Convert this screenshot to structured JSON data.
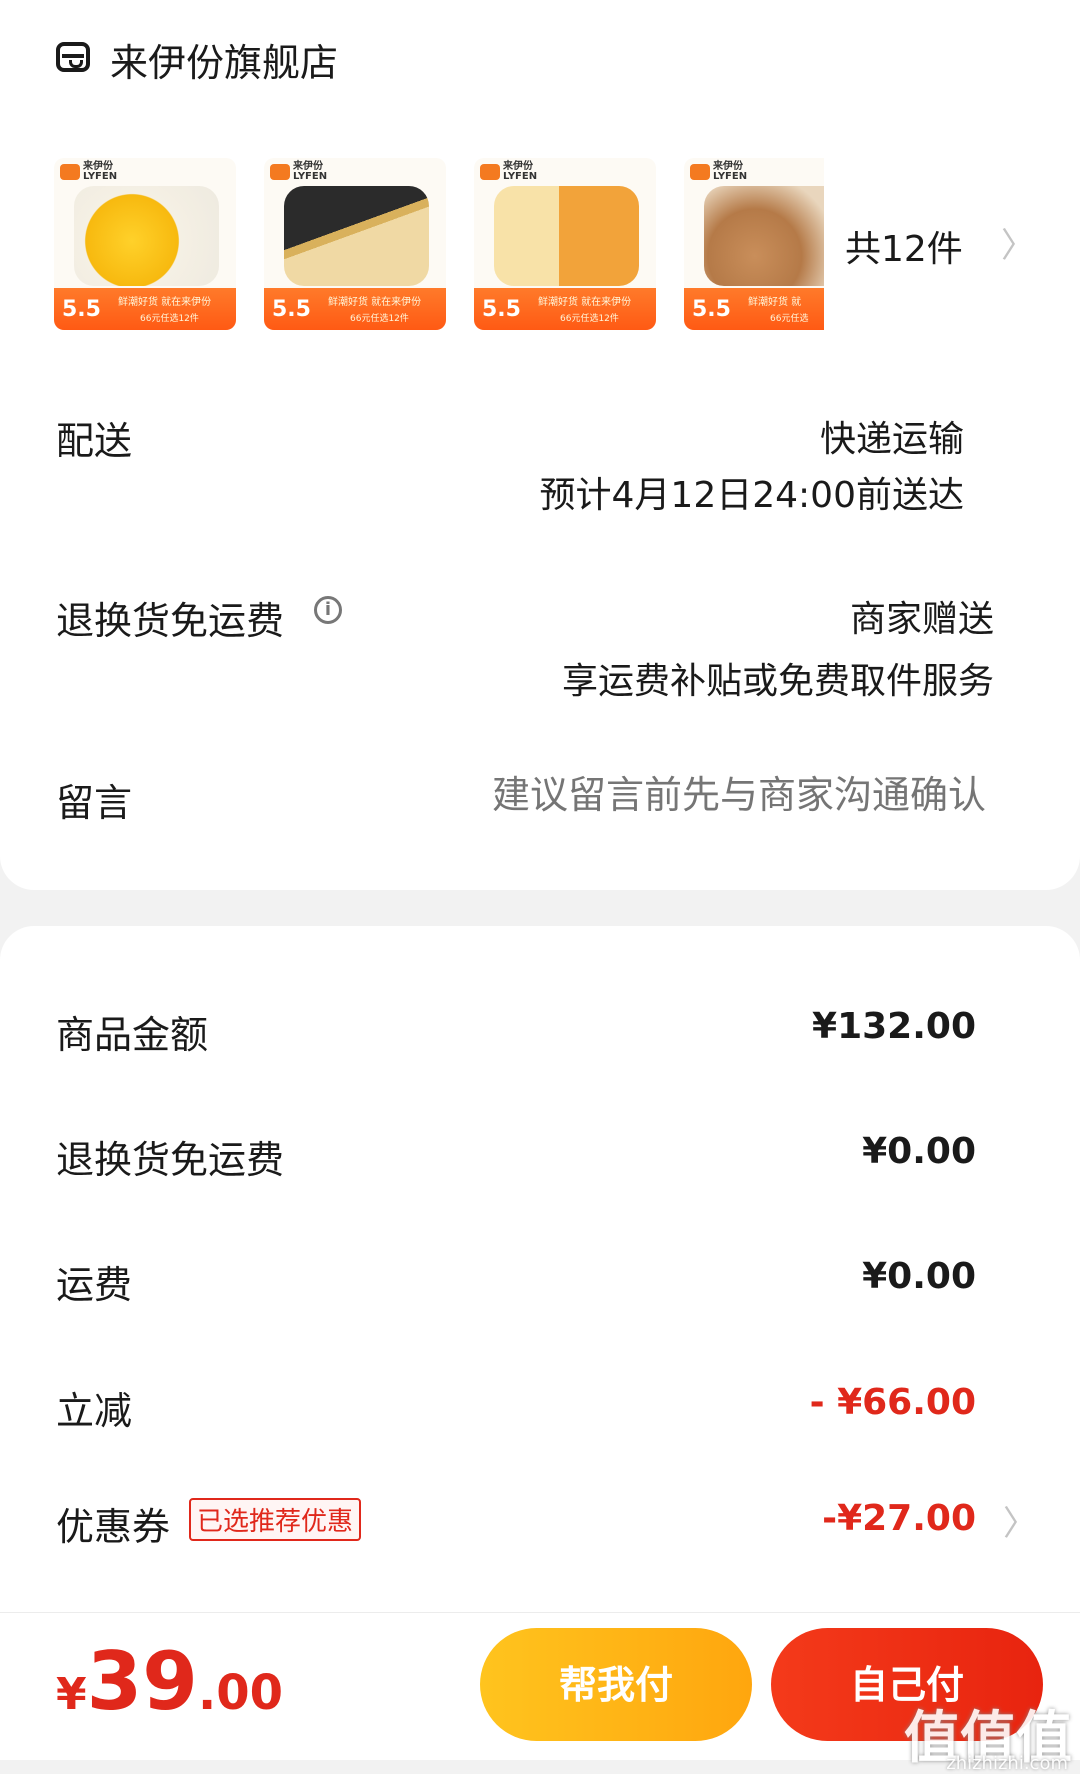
{
  "shop": {
    "name": "来伊份旗舰店"
  },
  "products": {
    "items": [
      {
        "brand_cn": "来伊份",
        "brand_en": "LYFEN",
        "price": "5.5",
        "pitch": "鲜潮好货 就在来伊份",
        "deal": "66元任选12件",
        "color": "#f7c21b"
      },
      {
        "brand_cn": "来伊份",
        "brand_en": "LYFEN",
        "price": "5.5",
        "pitch": "鲜潮好货 就在来伊份",
        "deal": "66元任选12件",
        "color": "#e2b45a"
      },
      {
        "brand_cn": "来伊份",
        "brand_en": "LYFEN",
        "price": "5.5",
        "pitch": "鲜潮好货 就在来伊份",
        "deal": "66元任选12件",
        "color": "#f0a43a"
      },
      {
        "brand_cn": "来伊份",
        "brand_en": "LYFEN",
        "price": "5.5",
        "pitch": "鲜潮好货 就",
        "deal": "66元任选",
        "color": "#c98e5a"
      }
    ],
    "count_label": "共12件"
  },
  "delivery": {
    "label": "配送",
    "method": "快递运输",
    "eta": "预计4月12日24:00前送达"
  },
  "return_shipping": {
    "label": "退换货免运费",
    "value": "商家赠送",
    "desc": "享运费补贴或免费取件服务"
  },
  "remark": {
    "label": "留言",
    "placeholder": "建议留言前先与商家沟通确认"
  },
  "summary": {
    "goods_label": "商品金额",
    "goods_value": "¥132.00",
    "return_label": "退换货免运费",
    "return_value": "¥0.00",
    "shipping_label": "运费",
    "shipping_value": "¥0.00",
    "discount_label": "立减",
    "discount_value": "- ¥66.00",
    "coupon_label": "优惠券",
    "coupon_tag": "已选推荐优惠",
    "coupon_value": "-¥27.00"
  },
  "footer": {
    "currency": "¥",
    "total_int": "39",
    "total_dec": ".00",
    "help_pay": "帮我付",
    "self_pay": "自己付",
    "watermark": "值值值",
    "watermark_url": "zhizhizhi.com"
  },
  "colors": {
    "accent_red": "#e0281b",
    "help_yellow": "#ffb716",
    "product_band": "#ff6a1e"
  }
}
